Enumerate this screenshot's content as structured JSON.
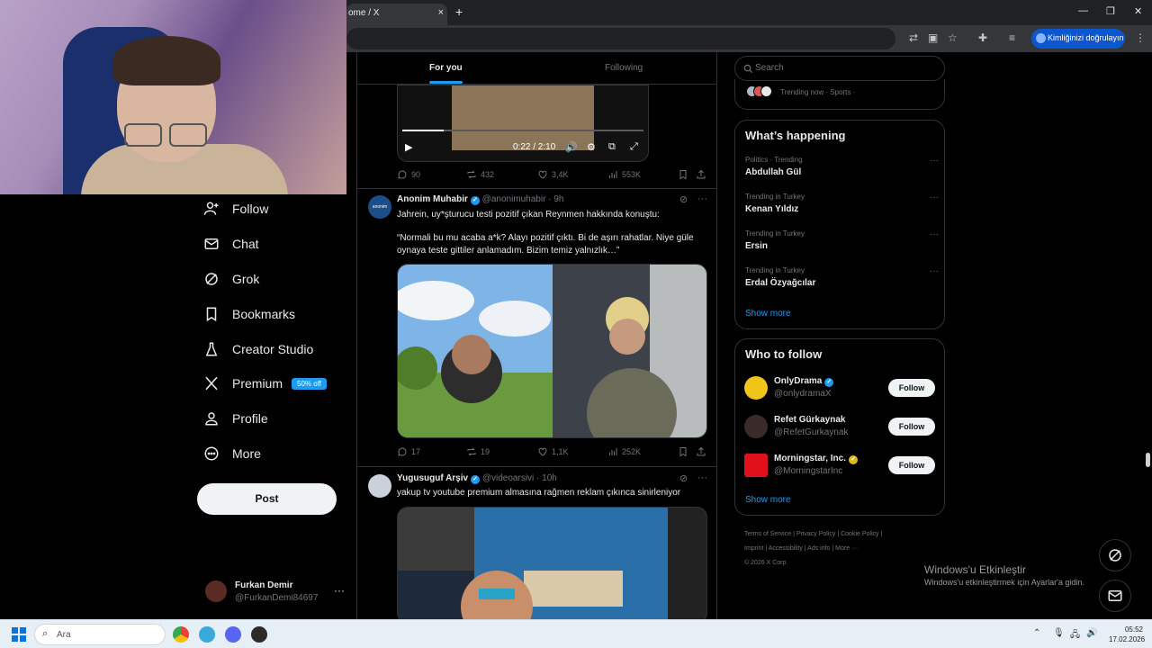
{
  "browser": {
    "tab_title": "ome / X",
    "tab_close": "×",
    "new_tab": "+",
    "profile_pill": "Kimliğinizi doğrulayın",
    "window_min": "—",
    "window_restore": "❐",
    "window_close": "✕"
  },
  "sidebar": {
    "items": [
      {
        "label": "Follow",
        "icon": "follow-icon"
      },
      {
        "label": "Chat",
        "icon": "mail-icon"
      },
      {
        "label": "Grok",
        "icon": "grok-icon"
      },
      {
        "label": "Bookmarks",
        "icon": "bookmark-icon"
      },
      {
        "label": "Creator Studio",
        "icon": "creator-icon"
      },
      {
        "label": "Premium",
        "icon": "x-logo-icon",
        "badge": "50% off"
      },
      {
        "label": "Profile",
        "icon": "person-icon"
      },
      {
        "label": "More",
        "icon": "more-circle-icon"
      }
    ],
    "post_label": "Post",
    "account": {
      "name": "Furkan Demir",
      "handle": "@FurkanDemi84697",
      "more": "···"
    }
  },
  "feed": {
    "tabs": {
      "for_you": "For you",
      "following": "Following"
    },
    "video": {
      "time": "0:22 / 2:10",
      "progress": 0.17
    },
    "tweet0_actions": {
      "replies": "90",
      "reposts": "432",
      "likes": "3,4K",
      "views": "553K"
    },
    "tweet1": {
      "name": "Anonim Muhabir",
      "handle": "@anonimuhabir · 9h",
      "line1": "Jahrein, uy*şturucu testi pozitif çıkan Reynmen hakkında konuştu:",
      "line2": "“Normali bu mu acaba a*k? Alayı pozitif çıktı. Bi de aşırı rahatlar. Niye güle oynaya teste gittiler anlamadım. Bizim temiz yalnızlık…”",
      "replies": "17",
      "reposts": "19",
      "likes": "1,1K",
      "views": "252K",
      "avatar_text": "anonim"
    },
    "tweet2": {
      "name": "Yugusuguf Arşiv",
      "handle": "@videoarsivi · 10h",
      "text": "yakup tv youtube premium almasına rağmen reklam çıkınca sinirleniyor"
    },
    "more": "···"
  },
  "right": {
    "search_placeholder": "Search",
    "trending_now": "Trending now · Sports ·",
    "happening_title": "What’s happening",
    "trends": [
      {
        "category": "Politics · Trending",
        "name": "Abdullah Gül"
      },
      {
        "category": "Trending in Turkey",
        "name": "Kenan Yıldız"
      },
      {
        "category": "Trending in Turkey",
        "name": "Ersin"
      },
      {
        "category": "Trending in Turkey",
        "name": "Erdal Özyağcılar"
      }
    ],
    "show_more": "Show more",
    "wtf_title": "Who to follow",
    "follow_suggestions": [
      {
        "name": "OnlyDrama",
        "handle": "@onlydramaX",
        "verified": true,
        "button": "Follow"
      },
      {
        "name": "Refet Gürkaynak",
        "handle": "@RefetGurkaynak",
        "verified": false,
        "button": "Follow"
      },
      {
        "name": "Morningstar, Inc.",
        "handle": "@MorningstarInc",
        "verified": true,
        "button": "Follow"
      }
    ],
    "footer": {
      "line1": "Terms of Service  |  Privacy Policy  |  Cookie Policy  |",
      "line2": "Imprint  |  Accessibility  |  Ads info  |  More ···",
      "line3": "© 2026 X Corp."
    }
  },
  "watermark": {
    "line1": "Windows'u Etkinleştir",
    "line2": "Windows'u etkinleştirmek için Ayarlar'a gidin."
  },
  "taskbar": {
    "search": "Ara",
    "time": "05:52",
    "date": "17.02.2026"
  },
  "colors": {
    "accent": "#1d9bf0",
    "background": "#000000",
    "taskbar": "#e6eef6"
  }
}
